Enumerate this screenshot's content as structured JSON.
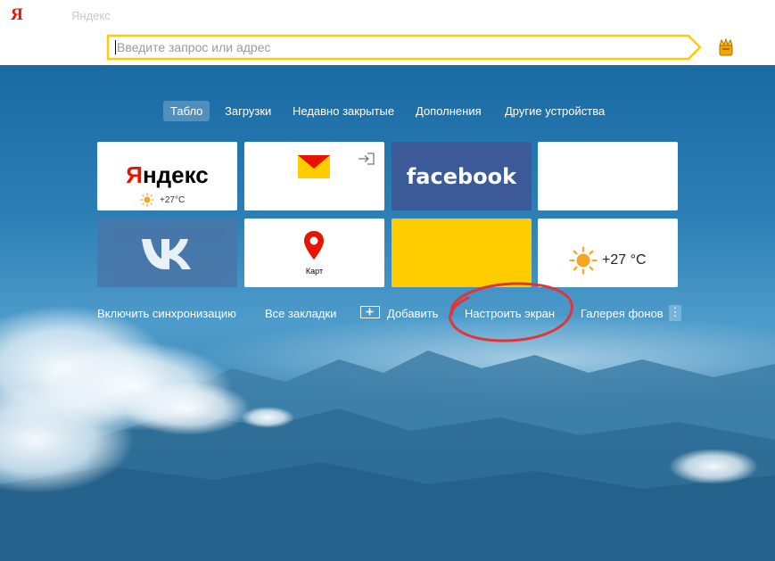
{
  "browser": {
    "logo": "Я",
    "tab_title": "Яндекс",
    "omnibox": {
      "placeholder": "Введите запрос или адрес",
      "value": ""
    },
    "colors": {
      "omnibox_border": "#ffcc00",
      "logo_red": "#e61400"
    }
  },
  "nav": {
    "items": [
      {
        "label": "Табло",
        "active": true
      },
      {
        "label": "Загрузки",
        "active": false
      },
      {
        "label": "Недавно закрытые",
        "active": false
      },
      {
        "label": "Дополнения",
        "active": false
      },
      {
        "label": "Другие устройства",
        "active": false
      }
    ]
  },
  "tiles": {
    "yandex": {
      "brand": "Яндекс",
      "brand_first": "Я",
      "brand_rest": "ндекс",
      "weather": "+27°C",
      "icon": "sun-icon"
    },
    "mail": {
      "icon": "mail-envelope-icon",
      "badge_icon": "enter-arrow-icon"
    },
    "facebook": {
      "brand": "facebook",
      "color": "#3c5a98"
    },
    "empty": {},
    "vk": {
      "brand": "VK",
      "icon": "vk-logo-icon",
      "color": "#4a76a8"
    },
    "maps": {
      "label": "Карт",
      "icon": "map-pin-icon"
    },
    "yellow": {
      "color": "#ffcc00"
    },
    "weather": {
      "temperature": "+27 °C",
      "icon": "sun-icon"
    }
  },
  "bottom": {
    "sync": "Включить синхронизацию",
    "bookmarks": "Все закладки",
    "add": "Добавить",
    "customize": "Настроить экран",
    "gallery": "Галерея фонов",
    "more": "⋮"
  },
  "annotation": {
    "highlight_color": "#e0353b",
    "target": "Настроить экран"
  }
}
